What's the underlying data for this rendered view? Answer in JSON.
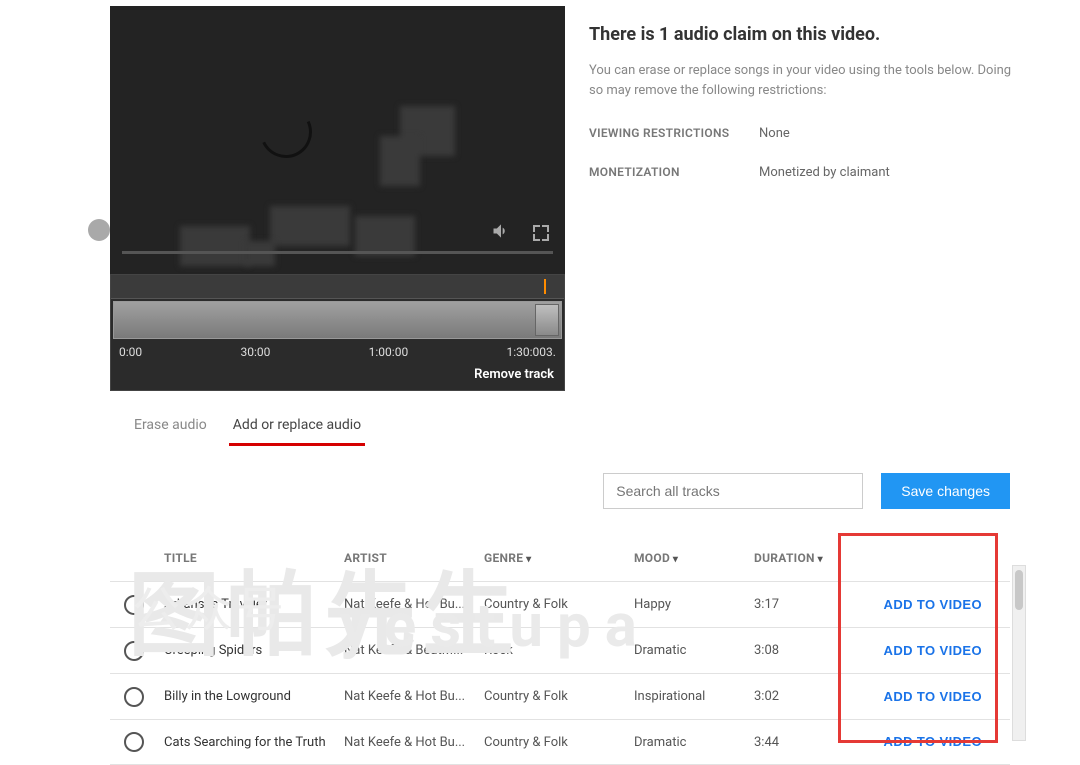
{
  "info": {
    "title": "There is 1 audio claim on this video.",
    "description": "You can erase or replace songs in your video using the tools below. Doing so may remove the following restrictions:",
    "restrictions_label": "VIEWING RESTRICTIONS",
    "restrictions_value": "None",
    "monetization_label": "MONETIZATION",
    "monetization_value": "Monetized by claimant"
  },
  "timeline": {
    "ticks": [
      "0:00",
      "30:00",
      "1:00:00",
      "1:30:003."
    ],
    "remove_label": "Remove track"
  },
  "tabs": {
    "erase": "Erase audio",
    "add_replace": "Add or replace audio"
  },
  "search": {
    "placeholder": "Search all tracks"
  },
  "save_label": "Save changes",
  "table": {
    "headers": {
      "title": "TITLE",
      "artist": "ARTIST",
      "genre": "GENRE",
      "mood": "MOOD",
      "duration": "DURATION"
    },
    "add_label": "ADD TO VIDEO",
    "rows": [
      {
        "title": "Arkansas Traveler",
        "artist": "Nat Keefe & Hot Bu...",
        "genre": "Country & Folk",
        "mood": "Happy",
        "duration": "3:17"
      },
      {
        "title": "Creeping Spiders",
        "artist": "Nat Keefe & BeatM...",
        "genre": "Rock",
        "mood": "Dramatic",
        "duration": "3:08"
      },
      {
        "title": "Billy in the Lowground",
        "artist": "Nat Keefe & Hot Bu...",
        "genre": "Country & Folk",
        "mood": "Inspirational",
        "duration": "3:02"
      },
      {
        "title": "Cats Searching for the Truth",
        "artist": "Nat Keefe & Hot Bu...",
        "genre": "Country & Folk",
        "mood": "Dramatic",
        "duration": "3:44"
      }
    ]
  },
  "watermark": {
    "cjk": "图帕先生",
    "lat": "yestupa",
    "small": "公众号"
  }
}
